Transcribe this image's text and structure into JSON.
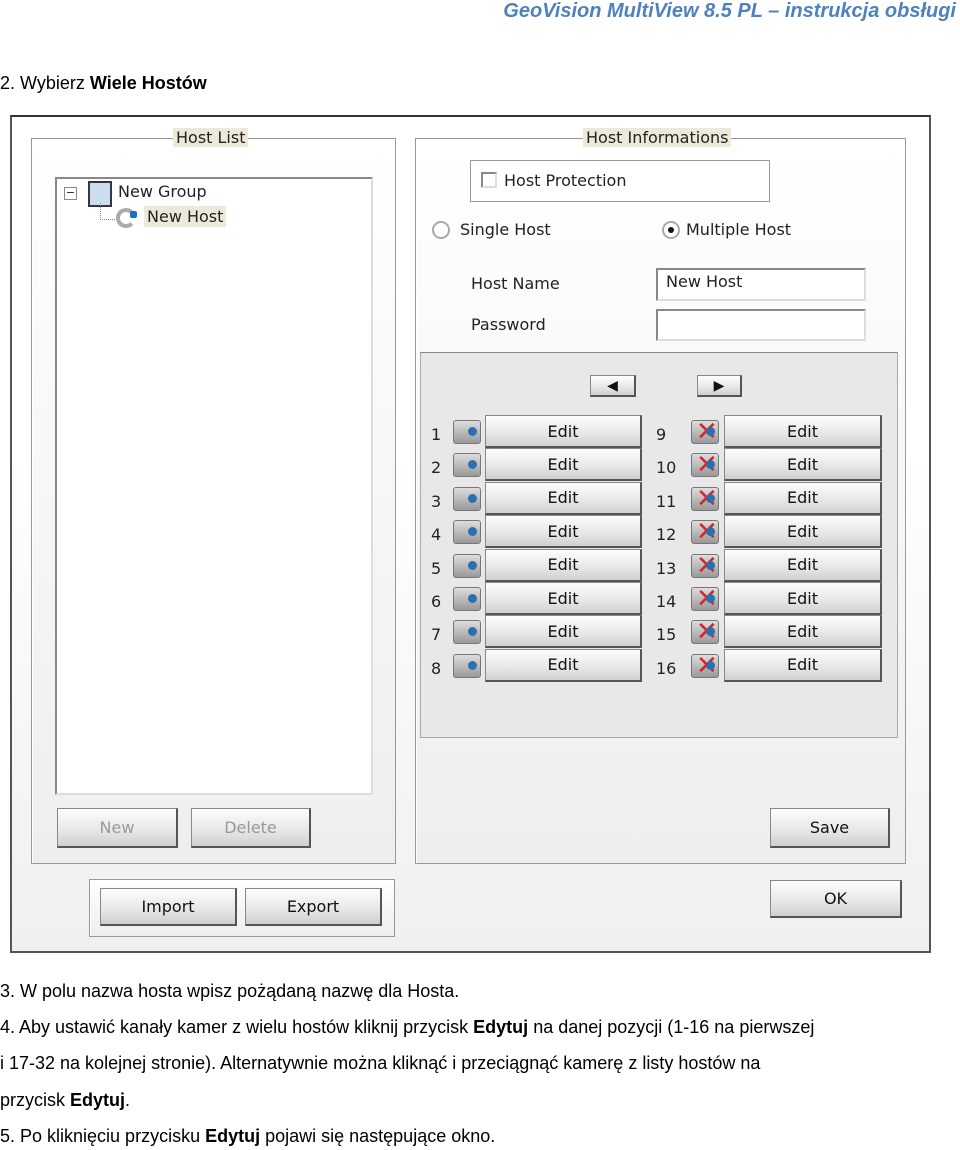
{
  "header": "GeoVision MultiView 8.5 PL – instrukcja obsługi",
  "step2": {
    "prefix": "2. Wybierz ",
    "bold": "Wiele Hostów"
  },
  "dialog": {
    "host_list": {
      "title": "Host List",
      "tree": {
        "group": "New Group",
        "host": "New Host"
      },
      "new_label": "New",
      "delete_label": "Delete",
      "import_label": "Import",
      "export_label": "Export"
    },
    "host_info": {
      "title": "Host Informations",
      "host_protection": "Host Protection",
      "host_protection_checked": false,
      "single_host": "Single Host",
      "multiple_host": "Multiple Host",
      "selected_mode": "Multiple Host",
      "host_name_label": "Host Name",
      "host_name_value": "New Host",
      "password_label": "Password",
      "password_value": "",
      "prev_icon": "arrow-left-icon",
      "next_icon": "arrow-right-icon",
      "channels_left": [
        {
          "n": "1",
          "edit": "Edit"
        },
        {
          "n": "2",
          "edit": "Edit"
        },
        {
          "n": "3",
          "edit": "Edit"
        },
        {
          "n": "4",
          "edit": "Edit"
        },
        {
          "n": "5",
          "edit": "Edit"
        },
        {
          "n": "6",
          "edit": "Edit"
        },
        {
          "n": "7",
          "edit": "Edit"
        },
        {
          "n": "8",
          "edit": "Edit"
        }
      ],
      "channels_right": [
        {
          "n": "9",
          "edit": "Edit"
        },
        {
          "n": "10",
          "edit": "Edit"
        },
        {
          "n": "11",
          "edit": "Edit"
        },
        {
          "n": "12",
          "edit": "Edit"
        },
        {
          "n": "13",
          "edit": "Edit"
        },
        {
          "n": "14",
          "edit": "Edit"
        },
        {
          "n": "15",
          "edit": "Edit"
        },
        {
          "n": "16",
          "edit": "Edit"
        }
      ],
      "save_label": "Save",
      "ok_label": "OK"
    }
  },
  "step3": "3. W polu nazwa hosta wpisz pożądaną nazwę dla Hosta.",
  "step4": {
    "a": "4. Aby ustawić kanały kamer z wielu hostów kliknij przycisk ",
    "b": "Edytuj",
    "c": " na danej pozycji (1-16 na pierwszej",
    "line2": "i 17-32 na kolejnej stronie). Alternatywnie można kliknąć i przeciągnąć kamerę z listy hostów na",
    "line3a": "przycisk ",
    "line3b": "Edytuj",
    "line3c": "."
  },
  "step5": {
    "a": "5. Po kliknięciu przycisku ",
    "b": "Edytuj",
    "c": " pojawi się następujące okno."
  }
}
